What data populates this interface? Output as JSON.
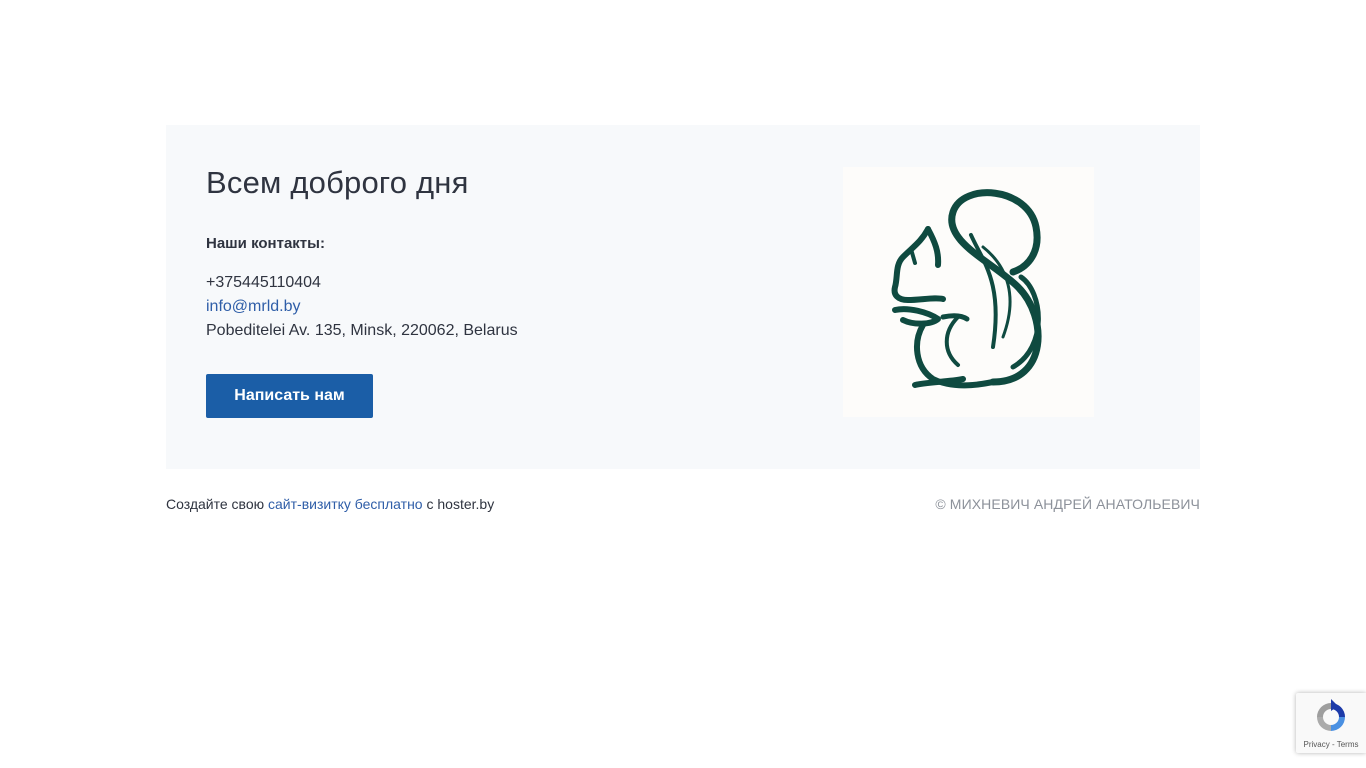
{
  "card": {
    "title": "Всем доброго дня",
    "contacts_label": "Наши контакты:",
    "phone": "+375445110404",
    "email": "info@mrld.by",
    "address": "Pobeditelei Av. 135, Minsk, 220062, Belarus",
    "button_label": "Написать нам",
    "logo_icon": "squirrel-logo-icon"
  },
  "footer": {
    "prefix": "Создайте свою",
    "link": "сайт-визитку бесплатно",
    "suffix": "с hoster.by",
    "copyright": "© МИХНЕВИЧ АНДРЕЙ АНАТОЛЬЕВИЧ"
  },
  "recaptcha": {
    "privacy": "Privacy",
    "separator": "-",
    "terms": "Terms",
    "icon": "recaptcha-icon"
  },
  "colors": {
    "button": "#1b5ea7",
    "link": "#2f5ea8",
    "logo": "#0f4a40",
    "card_bg": "#f7f9fb"
  }
}
